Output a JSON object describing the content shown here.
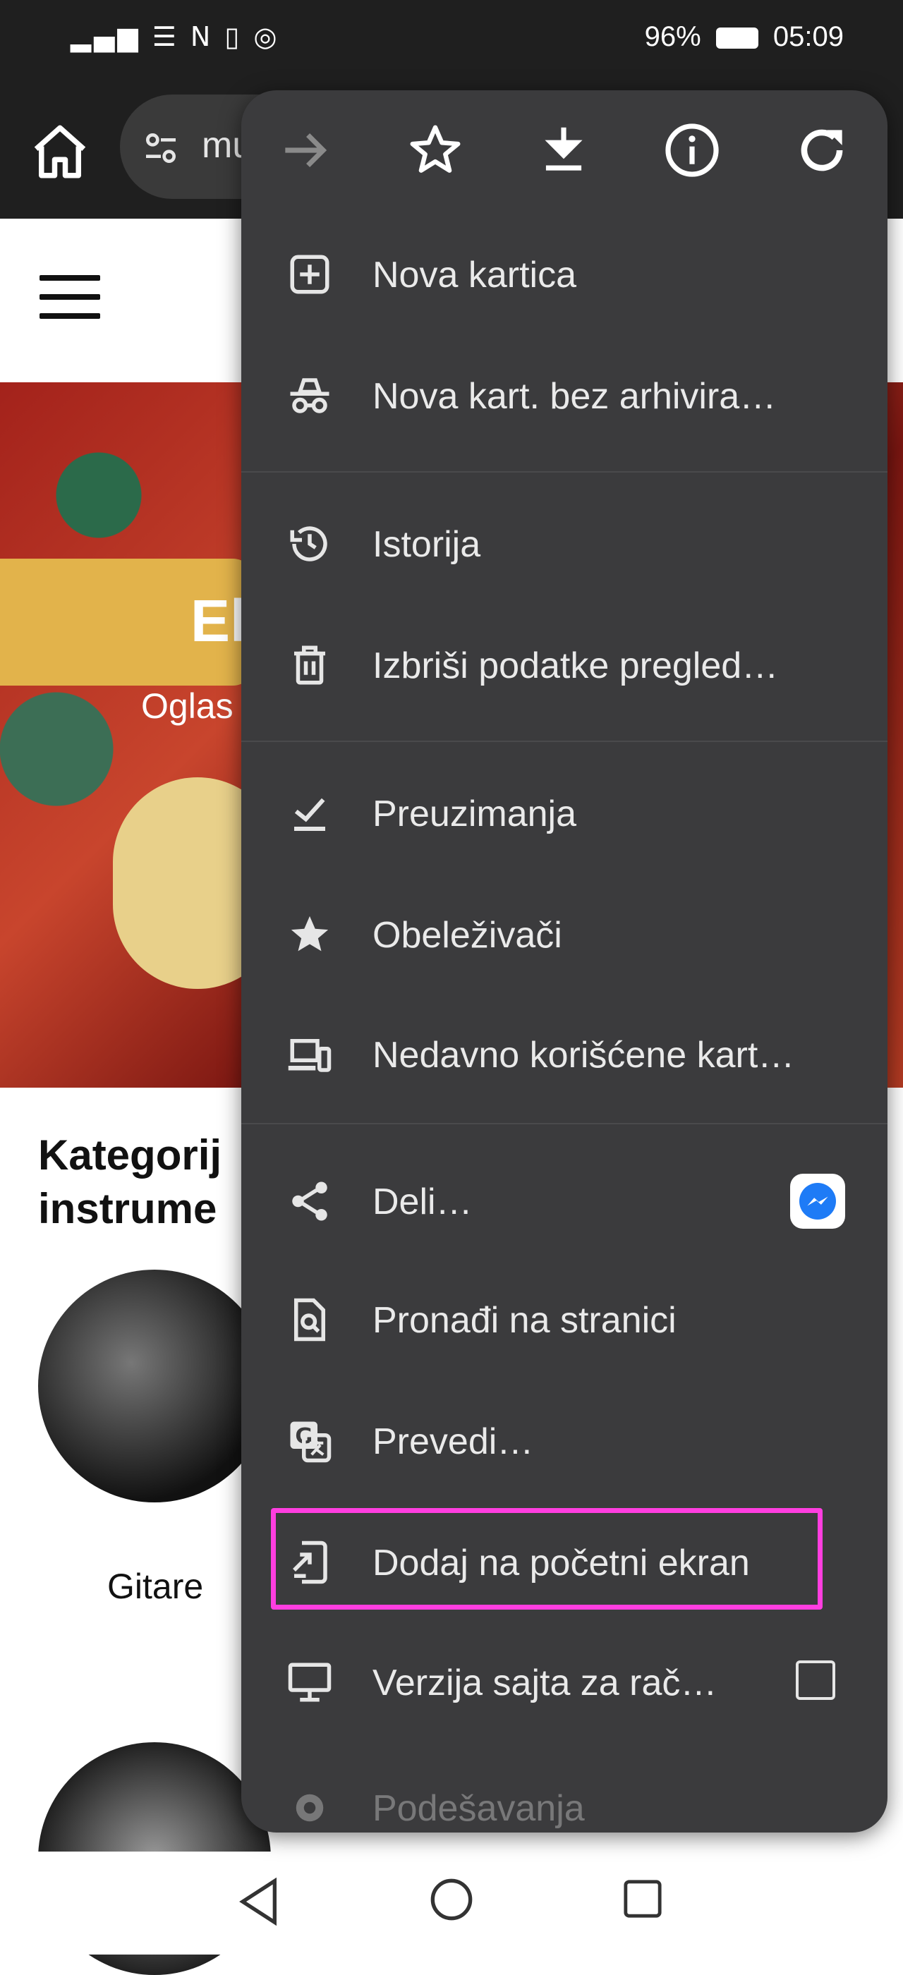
{
  "status_bar": {
    "signal_text": "▂▄▆ ☰ N ▯ ◎",
    "battery": "96%",
    "time": "05:09"
  },
  "url_bar": {
    "url_text": "mu"
  },
  "page": {
    "hero_title": "El",
    "hero_subtitle": "Oglas",
    "categories_title_line1": "Kategorij",
    "categories_title_line2": "instrume",
    "category_1_label": "Gitare"
  },
  "menu": {
    "toolbar": [
      "forward-icon",
      "star-icon",
      "download-icon",
      "info-icon",
      "refresh-icon"
    ],
    "items": [
      {
        "label": "Nova kartica",
        "icon": "add-tab-icon"
      },
      {
        "label": "Nova kart. bez arhivira…",
        "icon": "incognito-icon"
      },
      {
        "label": "Istorija",
        "icon": "history-icon"
      },
      {
        "label": "Izbriši podatke pregled…",
        "icon": "trash-icon"
      },
      {
        "label": "Preuzimanja",
        "icon": "downloads-check-icon"
      },
      {
        "label": "Obeleživači",
        "icon": "bookmark-star-icon"
      },
      {
        "label": "Nedavno korišćene kart…",
        "icon": "devices-icon"
      },
      {
        "label": "Deli…",
        "icon": "share-icon"
      },
      {
        "label": "Pronađi na stranici",
        "icon": "find-in-page-icon"
      },
      {
        "label": "Prevedi…",
        "icon": "translate-icon"
      },
      {
        "label": "Dodaj na početni ekran",
        "icon": "add-to-home-icon"
      },
      {
        "label": "Verzija sajta za rač…",
        "icon": "desktop-icon"
      },
      {
        "label": "Podešavanja",
        "icon": "settings-icon"
      }
    ],
    "highlight_color": "#ff3ee0"
  }
}
